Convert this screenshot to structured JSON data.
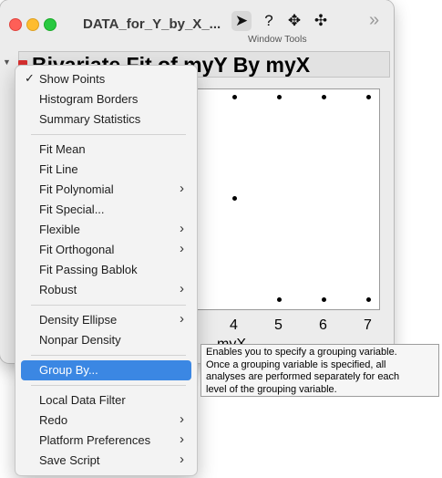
{
  "window": {
    "title": "DATA_for_Y_by_X_...",
    "tools_label": "Window Tools",
    "tools": [
      {
        "icon": "arrow-pointer-icon",
        "glyph": "➤"
      },
      {
        "icon": "help-icon",
        "glyph": "?"
      },
      {
        "icon": "crosshair-icon",
        "glyph": "✥"
      },
      {
        "icon": "move-icon",
        "glyph": "✣"
      }
    ],
    "overflow_glyph": "»"
  },
  "report": {
    "title": "Bivariate Fit of myY By myX"
  },
  "plot": {
    "x_ticks": [
      "4",
      "5",
      "6",
      "7"
    ],
    "x_label": "myX"
  },
  "chart_data": {
    "type": "scatter",
    "xlabel": "myX",
    "points": [
      {
        "x": 4,
        "y": "top"
      },
      {
        "x": 5,
        "y": "top"
      },
      {
        "x": 6,
        "y": "top"
      },
      {
        "x": 7,
        "y": "top"
      },
      {
        "x": 4,
        "y": "mid"
      },
      {
        "x": 5,
        "y": "bottom"
      },
      {
        "x": 6,
        "y": "bottom"
      },
      {
        "x": 7,
        "y": "bottom"
      }
    ]
  },
  "menu": {
    "items": [
      {
        "label": "Show Points",
        "checked": true,
        "submenu": false
      },
      {
        "label": "Histogram Borders",
        "checked": false,
        "submenu": false
      },
      {
        "label": "Summary Statistics",
        "checked": false,
        "submenu": false
      },
      {
        "label": "Fit Mean",
        "checked": false,
        "submenu": false
      },
      {
        "label": "Fit Line",
        "checked": false,
        "submenu": false
      },
      {
        "label": "Fit Polynomial",
        "checked": false,
        "submenu": true
      },
      {
        "label": "Fit Special...",
        "checked": false,
        "submenu": false
      },
      {
        "label": "Flexible",
        "checked": false,
        "submenu": true
      },
      {
        "label": "Fit Orthogonal",
        "checked": false,
        "submenu": true
      },
      {
        "label": "Fit Passing Bablok",
        "checked": false,
        "submenu": false
      },
      {
        "label": "Robust",
        "checked": false,
        "submenu": true
      },
      {
        "label": "Density Ellipse",
        "checked": false,
        "submenu": true
      },
      {
        "label": "Nonpar Density",
        "checked": false,
        "submenu": false
      },
      {
        "label": "Group By...",
        "checked": false,
        "submenu": false,
        "highlighted": true
      },
      {
        "label": "Local Data Filter",
        "checked": false,
        "submenu": false
      },
      {
        "label": "Redo",
        "checked": false,
        "submenu": true
      },
      {
        "label": "Platform Preferences",
        "checked": false,
        "submenu": true
      },
      {
        "label": "Save Script",
        "checked": false,
        "submenu": true
      }
    ],
    "check_glyph": "✓",
    "submenu_glyph": "›"
  },
  "tooltip": {
    "text": "Enables you to specify a grouping variable. Once a grouping variable is specified, all analyses are performed separately for each level of the grouping variable.",
    "lines": [
      "Enables you to specify a grouping variable.",
      "Once a grouping variable is specified, all",
      "analyses are performed separately for each",
      "level of the grouping variable."
    ]
  },
  "colors": {
    "highlight": "#3b87e3",
    "red_triangle": "#d83030"
  }
}
